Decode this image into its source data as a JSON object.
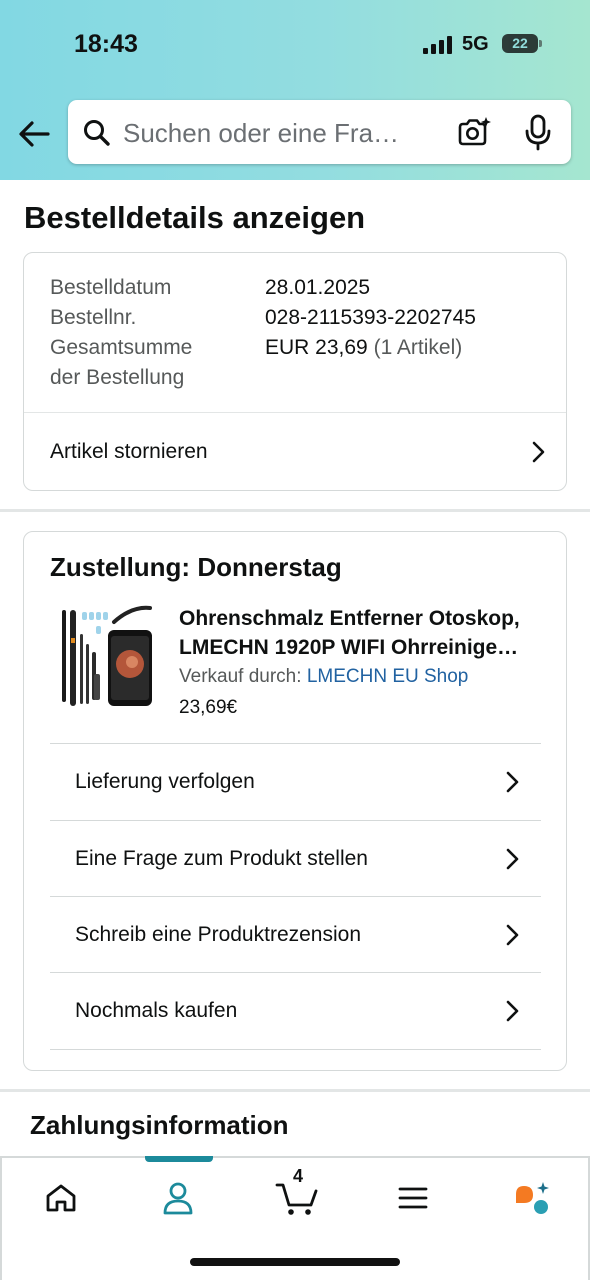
{
  "status_bar": {
    "time": "18:43",
    "network": "5G",
    "battery": "22"
  },
  "search": {
    "placeholder": "Suchen oder eine Fra…"
  },
  "page": {
    "title": "Bestelldetails anzeigen"
  },
  "order_summary": {
    "rows": [
      {
        "label": "Bestelldatum",
        "value": "28.01.2025"
      },
      {
        "label": "Bestellnr.",
        "value": "028-2115393-2202745"
      }
    ],
    "total_label_line1": "Gesamtsumme",
    "total_label_line2": "der Bestellung",
    "total_value": "EUR 23,69",
    "total_count": "(1 Artikel)",
    "cancel_label": "Artikel stornieren"
  },
  "delivery": {
    "title": "Zustellung: Donnerstag",
    "product": {
      "name_line1": "Ohrenschmalz Entferner Otoskop,",
      "name_line2": "LMECHN 1920P WIFI Ohrreinige…",
      "seller_prefix": "Verkauf durch:",
      "seller_name": "LMECHN EU Shop",
      "price": "23,69€"
    },
    "actions": [
      {
        "label": "Lieferung verfolgen"
      },
      {
        "label": "Eine Frage zum Produkt stellen"
      },
      {
        "label": "Schreib eine Produktrezension"
      },
      {
        "label": "Nochmals kaufen"
      }
    ]
  },
  "payment": {
    "title": "Zahlungsinformation"
  },
  "tabbar": {
    "cart_count": "4",
    "tabs": [
      "home-icon",
      "account-icon",
      "cart-icon",
      "menu-icon",
      "rufus-ai-icon"
    ],
    "active_color": "#1c8a9b"
  },
  "colors": {
    "link": "#2162a1",
    "header_start": "#82d8e3",
    "header_end": "#a5e6d0"
  }
}
